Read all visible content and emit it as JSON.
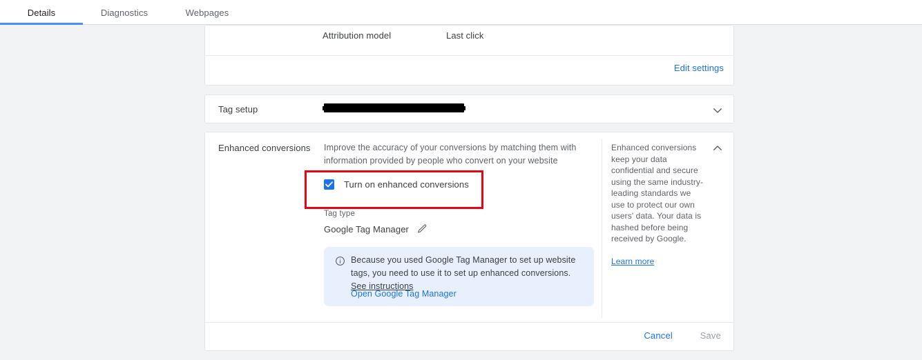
{
  "tabs": [
    {
      "label": "Details",
      "active": true
    },
    {
      "label": "Diagnostics",
      "active": false
    },
    {
      "label": "Webpages",
      "active": false
    }
  ],
  "attribution_card": {
    "label": "Attribution model",
    "value": "Last click",
    "edit_settings_label": "Edit settings"
  },
  "tag_setup_card": {
    "label": "Tag setup",
    "value_redacted": true,
    "expand_icon": "chevron-down-icon"
  },
  "enhanced_conversions_card": {
    "title": "Enhanced conversions",
    "description": "Improve the accuracy of your conversions by matching them with information provided by people who convert on your website",
    "checkbox": {
      "label": "Turn on enhanced conversions",
      "checked": true,
      "highlighted": true,
      "highlight_color": "#e30613"
    },
    "tag_type": {
      "label": "Tag type",
      "value": "Google Tag Manager",
      "edit_icon": "pencil-icon"
    },
    "info_box": {
      "icon": "info-icon",
      "text": "Because you used Google Tag Manager to set up website tags, you need to use it to set up enhanced conversions.",
      "link_label": "See instructions",
      "action_label": "Open Google Tag Manager"
    },
    "side_panel": {
      "text": "Enhanced conversions keep your data confidential and secure using the same industry-leading standards we use to protect our own users' data. Your data is hashed before being received by Google.",
      "learn_more_label": "Learn more",
      "collapse_icon": "chevron-up-icon"
    },
    "actions": {
      "cancel_label": "Cancel",
      "save_label": "Save",
      "save_disabled": true
    }
  },
  "colors": {
    "accent": "#1a73e8",
    "page_background": "#f1f3f4",
    "card_background": "#ffffff",
    "info_background": "#e8f0fe",
    "highlight": "#e30613",
    "tab_indicator": "#4b8df8",
    "disabled_text": "#9aa0a6"
  }
}
